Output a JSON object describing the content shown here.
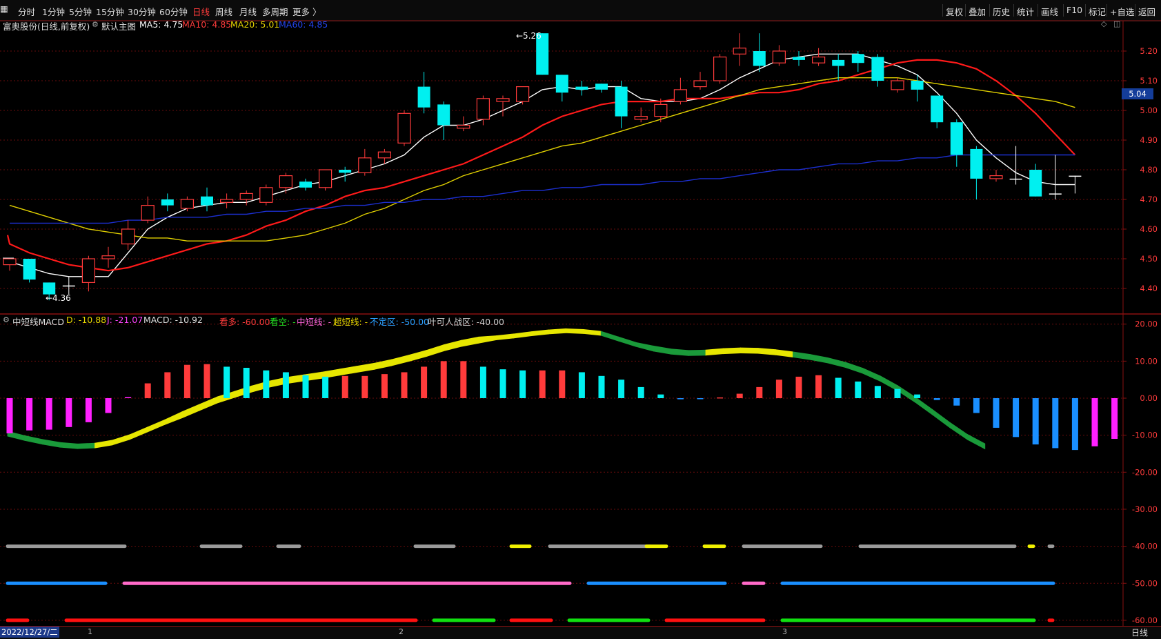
{
  "toolbar": {
    "left": [
      "分时",
      "1分钟",
      "5分钟",
      "15分钟",
      "30分钟",
      "60分钟",
      "日线",
      "周线",
      "月线",
      "多周期",
      "更多 〉"
    ],
    "active_index": 6,
    "right": [
      "复权",
      "叠加",
      "历史",
      "统计",
      "画线",
      "F10",
      "标记",
      "+自选",
      "返回"
    ]
  },
  "main_header": {
    "title": "富奥股份(日线,前复权)",
    "template": "默认主图",
    "ma5": "MA5: 4.75",
    "ma10": "MA10: 4.85",
    "ma20": "MA20: 5.01",
    "ma60": "MA60: 4.85"
  },
  "sub_header": {
    "name": "中短线MACD",
    "d": "D: -10.88",
    "j": "J: -21.07",
    "macd": "MACD: -10.92",
    "kanduo": "看多: -60.00",
    "kankong": "看空: -",
    "zhongduan": "中短线: -",
    "chaoduan": "超短线: -",
    "buding": "不定区: -50.00",
    "yeke": "叶可人战区: -40.00"
  },
  "status": {
    "date": "2022/12/27/二",
    "months": [
      "1",
      "2",
      "3"
    ],
    "period": "日线"
  },
  "colors": {
    "up": "#ff3b3b",
    "down": "#00f0f0",
    "ma5": "#ffffff",
    "ma10": "#ff1a1a",
    "ma20": "#e0d000",
    "ma60": "#1c2fd0",
    "grid": "#8a1010"
  },
  "chart_data": [
    {
      "type": "candlestick",
      "title": "富奥股份(日线,前复权)",
      "y_ticks": [
        "5.20",
        "5.10",
        "5.00",
        "4.90",
        "4.80",
        "4.70",
        "4.60",
        "4.50",
        "4.40"
      ],
      "ylim": [
        4.32,
        5.3
      ],
      "current_price_label": "5.04",
      "high_marker": "5.26",
      "low_marker": "4.36",
      "candles": [
        [
          4.48,
          4.5,
          4.46,
          4.5
        ],
        [
          4.5,
          4.43,
          4.42,
          4.5
        ],
        [
          4.42,
          4.38,
          4.36,
          4.42
        ],
        [
          4.41,
          4.41,
          4.38,
          4.44
        ],
        [
          4.42,
          4.5,
          4.39,
          4.51
        ],
        [
          4.5,
          4.51,
          4.47,
          4.54
        ],
        [
          4.55,
          4.6,
          4.53,
          4.63
        ],
        [
          4.63,
          4.68,
          4.62,
          4.71
        ],
        [
          4.7,
          4.68,
          4.66,
          4.72
        ],
        [
          4.67,
          4.7,
          4.66,
          4.71
        ],
        [
          4.71,
          4.68,
          4.66,
          4.74
        ],
        [
          4.69,
          4.7,
          4.67,
          4.72
        ],
        [
          4.7,
          4.72,
          4.68,
          4.73
        ],
        [
          4.69,
          4.74,
          4.68,
          4.75
        ],
        [
          4.74,
          4.78,
          4.72,
          4.79
        ],
        [
          4.76,
          4.74,
          4.73,
          4.77
        ],
        [
          4.74,
          4.8,
          4.73,
          4.8
        ],
        [
          4.8,
          4.79,
          4.76,
          4.81
        ],
        [
          4.79,
          4.84,
          4.78,
          4.87
        ],
        [
          4.84,
          4.86,
          4.82,
          4.87
        ],
        [
          4.89,
          4.99,
          4.88,
          5.0
        ],
        [
          5.08,
          5.01,
          4.99,
          5.13
        ],
        [
          5.02,
          4.95,
          4.9,
          5.03
        ],
        [
          4.94,
          4.95,
          4.93,
          4.98
        ],
        [
          4.97,
          5.04,
          4.95,
          5.05
        ],
        [
          5.03,
          5.04,
          4.98,
          5.05
        ],
        [
          5.03,
          5.08,
          5.02,
          5.08
        ],
        [
          5.26,
          5.12,
          5.12,
          5.26
        ],
        [
          5.12,
          5.06,
          5.03,
          5.12
        ],
        [
          5.08,
          5.07,
          5.05,
          5.1
        ],
        [
          5.09,
          5.07,
          5.06,
          5.09
        ],
        [
          5.08,
          4.98,
          4.94,
          5.1
        ],
        [
          4.97,
          4.98,
          4.96,
          5.01
        ],
        [
          4.98,
          5.02,
          4.96,
          5.04
        ],
        [
          5.03,
          5.07,
          5.02,
          5.11
        ],
        [
          5.08,
          5.1,
          5.07,
          5.13
        ],
        [
          5.1,
          5.18,
          5.09,
          5.19
        ],
        [
          5.19,
          5.21,
          5.15,
          5.26
        ],
        [
          5.2,
          5.15,
          5.13,
          5.26
        ],
        [
          5.16,
          5.2,
          5.15,
          5.22
        ],
        [
          5.18,
          5.17,
          5.15,
          5.2
        ],
        [
          5.16,
          5.18,
          5.15,
          5.21
        ],
        [
          5.17,
          5.15,
          5.1,
          5.19
        ],
        [
          5.19,
          5.16,
          5.13,
          5.2
        ],
        [
          5.18,
          5.1,
          5.08,
          5.19
        ],
        [
          5.07,
          5.1,
          5.06,
          5.11
        ],
        [
          5.1,
          5.07,
          5.03,
          5.12
        ],
        [
          5.05,
          4.96,
          4.94,
          5.05
        ],
        [
          4.96,
          4.85,
          4.81,
          4.97
        ],
        [
          4.87,
          4.77,
          4.7,
          4.88
        ],
        [
          4.77,
          4.78,
          4.76,
          4.8
        ],
        [
          4.77,
          4.77,
          4.75,
          4.88
        ],
        [
          4.8,
          4.71,
          4.71,
          4.82
        ],
        [
          4.72,
          4.72,
          4.7,
          4.85
        ],
        [
          4.78,
          4.78,
          4.72,
          4.78
        ]
      ],
      "series": [
        {
          "name": "MA5",
          "values": [
            4.49,
            4.47,
            4.45,
            4.44,
            4.44,
            4.44,
            4.52,
            4.6,
            4.64,
            4.67,
            4.68,
            4.69,
            4.69,
            4.71,
            4.73,
            4.75,
            4.76,
            4.78,
            4.8,
            4.82,
            4.85,
            4.91,
            4.95,
            4.95,
            4.97,
            5.0,
            5.03,
            5.07,
            5.08,
            5.07,
            5.08,
            5.08,
            5.04,
            5.03,
            5.03,
            5.04,
            5.07,
            5.11,
            5.14,
            5.17,
            5.18,
            5.19,
            5.19,
            5.19,
            5.17,
            5.15,
            5.12,
            5.06,
            4.99,
            4.9,
            4.84,
            4.79,
            4.76,
            4.75,
            4.75
          ]
        },
        {
          "name": "MA10",
          "values": [
            4.58,
            4.55,
            4.52,
            4.5,
            4.48,
            4.47,
            4.46,
            4.47,
            4.49,
            4.51,
            4.53,
            4.55,
            4.56,
            4.58,
            4.61,
            4.63,
            4.66,
            4.68,
            4.71,
            4.73,
            4.74,
            4.76,
            4.78,
            4.8,
            4.82,
            4.85,
            4.88,
            4.91,
            4.95,
            4.98,
            5.0,
            5.02,
            5.03,
            5.03,
            5.03,
            5.04,
            5.04,
            5.04,
            5.05,
            5.06,
            5.06,
            5.07,
            5.09,
            5.1,
            5.12,
            5.14,
            5.16,
            5.17,
            5.17,
            5.16,
            5.14,
            5.1,
            5.05,
            4.99,
            4.92,
            4.85
          ]
        },
        {
          "name": "MA20",
          "values": [
            4.68,
            4.66,
            4.64,
            4.62,
            4.6,
            4.59,
            4.58,
            4.57,
            4.57,
            4.56,
            4.56,
            4.56,
            4.56,
            4.56,
            4.57,
            4.58,
            4.6,
            4.62,
            4.65,
            4.67,
            4.7,
            4.73,
            4.75,
            4.78,
            4.8,
            4.82,
            4.84,
            4.86,
            4.88,
            4.89,
            4.91,
            4.93,
            4.95,
            4.97,
            4.99,
            5.01,
            5.03,
            5.05,
            5.07,
            5.08,
            5.09,
            5.1,
            5.11,
            5.11,
            5.11,
            5.11,
            5.1,
            5.09,
            5.08,
            5.07,
            5.06,
            5.05,
            5.04,
            5.03,
            5.01
          ]
        },
        {
          "name": "MA60",
          "values": [
            4.62,
            4.62,
            4.62,
            4.62,
            4.62,
            4.62,
            4.63,
            4.63,
            4.64,
            4.64,
            4.64,
            4.65,
            4.65,
            4.66,
            4.66,
            4.67,
            4.67,
            4.68,
            4.68,
            4.69,
            4.69,
            4.7,
            4.7,
            4.71,
            4.71,
            4.72,
            4.73,
            4.73,
            4.74,
            4.74,
            4.75,
            4.75,
            4.75,
            4.76,
            4.76,
            4.77,
            4.77,
            4.78,
            4.79,
            4.8,
            4.8,
            4.81,
            4.82,
            4.82,
            4.83,
            4.83,
            4.84,
            4.84,
            4.85,
            4.85,
            4.85,
            4.85,
            4.85,
            4.85,
            4.85
          ]
        }
      ]
    },
    {
      "type": "bar",
      "title": "中短线MACD",
      "y_ticks": [
        "20.00",
        "10.00",
        "0.00",
        "-10.00",
        "-20.00",
        "-30.00",
        "-40.00",
        "-50.00",
        "-60.00"
      ],
      "ylim": [
        -62,
        22
      ],
      "bars": [
        -9.5,
        -8.7,
        -8.5,
        -7.8,
        -6.5,
        -4.0,
        0.3,
        4.0,
        7.0,
        9.0,
        9.2,
        8.5,
        8.2,
        7.5,
        7.0,
        6.2,
        5.8,
        6.0,
        6.0,
        6.5,
        7.0,
        8.5,
        10.0,
        10.0,
        8.5,
        7.8,
        7.5,
        7.5,
        7.5,
        7.0,
        6.0,
        5.0,
        3.0,
        1.0,
        -0.3,
        -0.2,
        0.2,
        1.2,
        3.0,
        5.0,
        5.8,
        6.2,
        5.5,
        4.5,
        3.3,
        2.5,
        1.0,
        -0.5,
        -2.0,
        -4.0,
        -8.0,
        -10.5,
        -12.5,
        -13.5,
        -14.0,
        -13.0,
        -11.0
      ],
      "band_d": [
        -9.6,
        -10.8,
        -11.8,
        -12.6,
        -13.0,
        -12.8,
        -12.0,
        -10.5,
        -8.5,
        -6.5,
        -4.5,
        -2.5,
        -0.5,
        1.0,
        2.5,
        3.8,
        4.8,
        5.5,
        6.2,
        7.0,
        7.8,
        8.6,
        9.6,
        10.8,
        12.1,
        13.6,
        14.8,
        15.7,
        16.3,
        16.8,
        17.4,
        17.9,
        18.2,
        18.0,
        17.5,
        16.0,
        14.5,
        13.4,
        12.6,
        12.2,
        12.3,
        12.7,
        12.9,
        12.8,
        12.4,
        11.8,
        11.1,
        10.2,
        9.0,
        7.4,
        5.3,
        2.7,
        -0.4,
        -3.8,
        -7.3,
        -10.5,
        -13.0
      ]
    }
  ]
}
